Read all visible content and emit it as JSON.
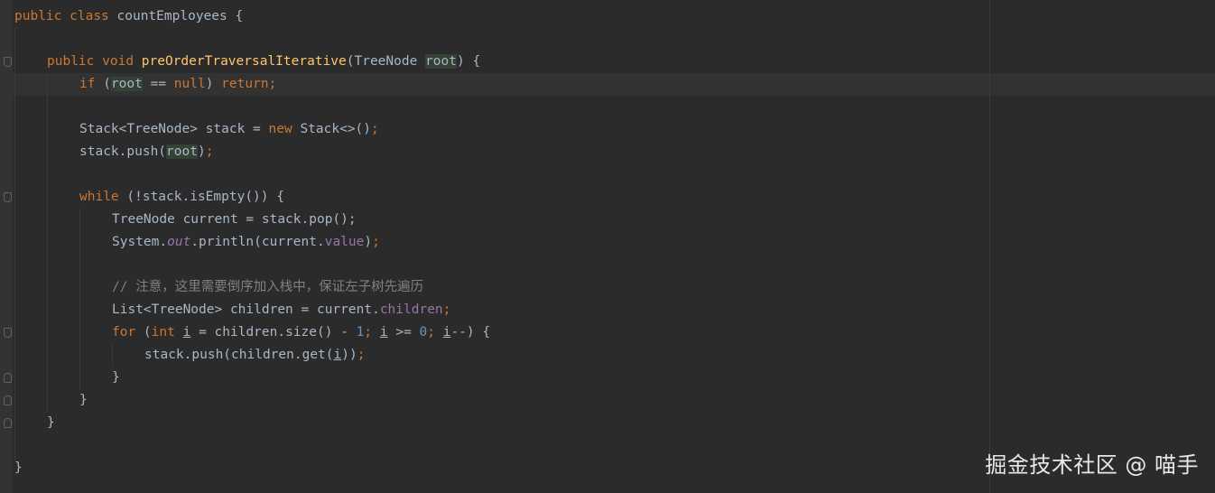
{
  "code": {
    "class_decl": {
      "kw_public": "public",
      "kw_class": "class",
      "class_name": "countEmployees",
      "brace": " {"
    },
    "method_decl": {
      "kw_public": "public",
      "kw_void": "void",
      "name": "preOrderTraversalIterative",
      "open": "(TreeNode ",
      "param": "root",
      "close": ") {"
    },
    "if_stmt": {
      "kw_if": "if",
      "open": " (",
      "var": "root",
      "op": " == ",
      "kw_null": "null",
      "close": ") ",
      "kw_return": "return",
      "semi": ";"
    },
    "stack_decl": {
      "lhs": "Stack<TreeNode> stack = ",
      "kw_new": "new",
      "rhs": " Stack<>()",
      "semi": ";"
    },
    "stack_push_root": {
      "call": "stack.push(",
      "var": "root",
      "close": ")",
      "semi": ";"
    },
    "while_stmt": {
      "kw_while": "while",
      "rest": " (!stack.isEmpty()) {"
    },
    "current_decl": {
      "text": "TreeNode current = stack.pop();"
    },
    "println_stmt": {
      "prefix": "System.",
      "field_out": "out",
      "mid": ".println(current.",
      "field_value": "value",
      "close": ")",
      "semi": ";"
    },
    "comment": {
      "text": "// 注意，这里需要倒序加入栈中，保证左子树先遍历"
    },
    "children_decl": {
      "lhs": "List<TreeNode> children = current.",
      "field_children": "children",
      "semi": ";"
    },
    "for_stmt": {
      "kw_for": "for",
      "open": " (",
      "kw_int": "int",
      "var_i1": "i",
      "mid1": " = children.size() - ",
      "num1": "1",
      "semi1": ";",
      "var_i2": "i",
      "mid2": " >= ",
      "num0": "0",
      "semi2": ";",
      "var_i3": "i",
      "close": "--) {"
    },
    "push_child": {
      "call": "stack.push(children.get(",
      "var_i": "i",
      "close": "))",
      "semi": ";"
    },
    "brace": "}"
  },
  "watermark": "掘金技术社区 @ 喵手"
}
